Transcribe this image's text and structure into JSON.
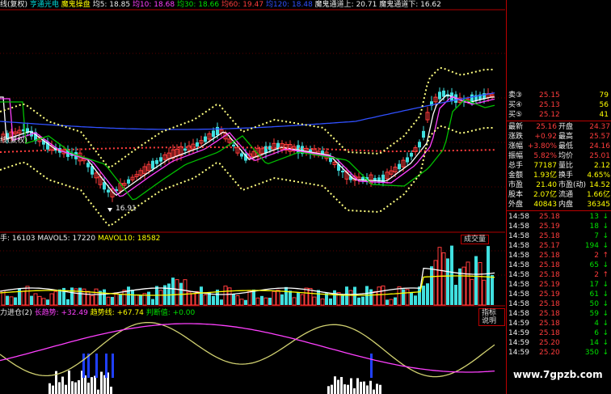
{
  "header": {
    "left_label": "线(复权)",
    "ticker_label": "亨通光电",
    "indicator": "魔鬼操盘",
    "ma5": "均5: 18.85",
    "ma10": "均10: 18.68",
    "ma30": "均30: 18.66",
    "ma60": "均60: 19.47",
    "ma120": "均120: 18.48",
    "channel_upper": "魔鬼通道上: 20.71",
    "channel_lower": "魔鬼通道下: 16.62"
  },
  "left_labels": {
    "top": "线(复权)",
    "mid": "线(复权)"
  },
  "price_panel": {
    "low_marker": "16.91"
  },
  "volume_panel": {
    "label": "手: 16103",
    "mavol5": "MAVOL5: 17220",
    "mavol10": "MAVOL10: 18582",
    "button": "成交量"
  },
  "indicator_panel": {
    "label": "力进仓(2)",
    "long_trend": "长趋势: +32.49",
    "trend_line": "趋势线: +67.74",
    "judge": "判断值: +0.00",
    "button": "指标说明"
  },
  "quotes": {
    "asks": [
      {
        "label": "卖③",
        "price": "25.15",
        "vol": "79"
      },
      {
        "label": "买④",
        "price": "25.13",
        "vol": "56"
      },
      {
        "label": "买⑤",
        "price": "25.12",
        "vol": "41"
      }
    ],
    "stats": [
      {
        "l1": "最新",
        "v1": "25.16",
        "l2": "开盘",
        "v2": "24.37"
      },
      {
        "l1": "涨跌",
        "v1": "+0.92",
        "l2": "最高",
        "v2": "25.57"
      },
      {
        "l1": "涨幅",
        "v1": "+3.80%",
        "l2": "最低",
        "v2": "24.16"
      },
      {
        "l1": "振幅",
        "v1": "5.82%",
        "l2": "均价",
        "v2": "25.01"
      },
      {
        "l1": "总手",
        "v1": "77187",
        "l2": "量比",
        "v2": "2.12"
      },
      {
        "l1": "金额",
        "v1": "1.93亿",
        "l2": "换手",
        "v2": "4.65%"
      },
      {
        "l1": "市盈",
        "v1": "21.40",
        "l2": "市盈(动)",
        "v2": "14.52"
      },
      {
        "l1": "股本",
        "v1": "2.07亿",
        "l2": "流通",
        "v2": "1.66亿"
      },
      {
        "l1": "外盘",
        "v1": "40843",
        "l2": "内盘",
        "v2": "36345"
      }
    ],
    "ticks": [
      {
        "time": "14:58",
        "price": "25.18",
        "vol": "13",
        "dir": "down"
      },
      {
        "time": "14:58",
        "price": "25.19",
        "vol": "18",
        "dir": "down"
      },
      {
        "time": "14:58",
        "price": "25.18",
        "vol": "7",
        "dir": "down"
      },
      {
        "time": "14:58",
        "price": "25.17",
        "vol": "194",
        "dir": "down"
      },
      {
        "time": "14:58",
        "price": "25.18",
        "vol": "2",
        "dir": "up"
      },
      {
        "time": "14:58",
        "price": "25.18",
        "vol": "65",
        "dir": "down"
      },
      {
        "time": "14:58",
        "price": "25.18",
        "vol": "2",
        "dir": "up"
      },
      {
        "time": "14:58",
        "price": "25.19",
        "vol": "17",
        "dir": "down"
      },
      {
        "time": "14:58",
        "price": "25.19",
        "vol": "61",
        "dir": "down"
      },
      {
        "time": "14:58",
        "price": "25.18",
        "vol": "50",
        "dir": "down"
      },
      {
        "time": "14:58",
        "price": "25.18",
        "vol": "59",
        "dir": "down"
      },
      {
        "time": "14:59",
        "price": "25.18",
        "vol": "4",
        "dir": "down"
      },
      {
        "time": "14:59",
        "price": "25.18",
        "vol": "6",
        "dir": "down"
      },
      {
        "time": "14:59",
        "price": "25.20",
        "vol": "14",
        "dir": "down"
      },
      {
        "time": "14:59",
        "price": "25.20",
        "vol": "350",
        "dir": "down"
      }
    ]
  },
  "watermark": "www.7gpzb.com",
  "colors": {
    "up": "#ff3c3c",
    "down": "#00e000",
    "ma_blue": "#3050ff",
    "ma_magenta": "#ff40ff",
    "ma_yellow": "#ffff00",
    "vol_cyan": "#40e0e0",
    "frame_red": "#b00000"
  }
}
